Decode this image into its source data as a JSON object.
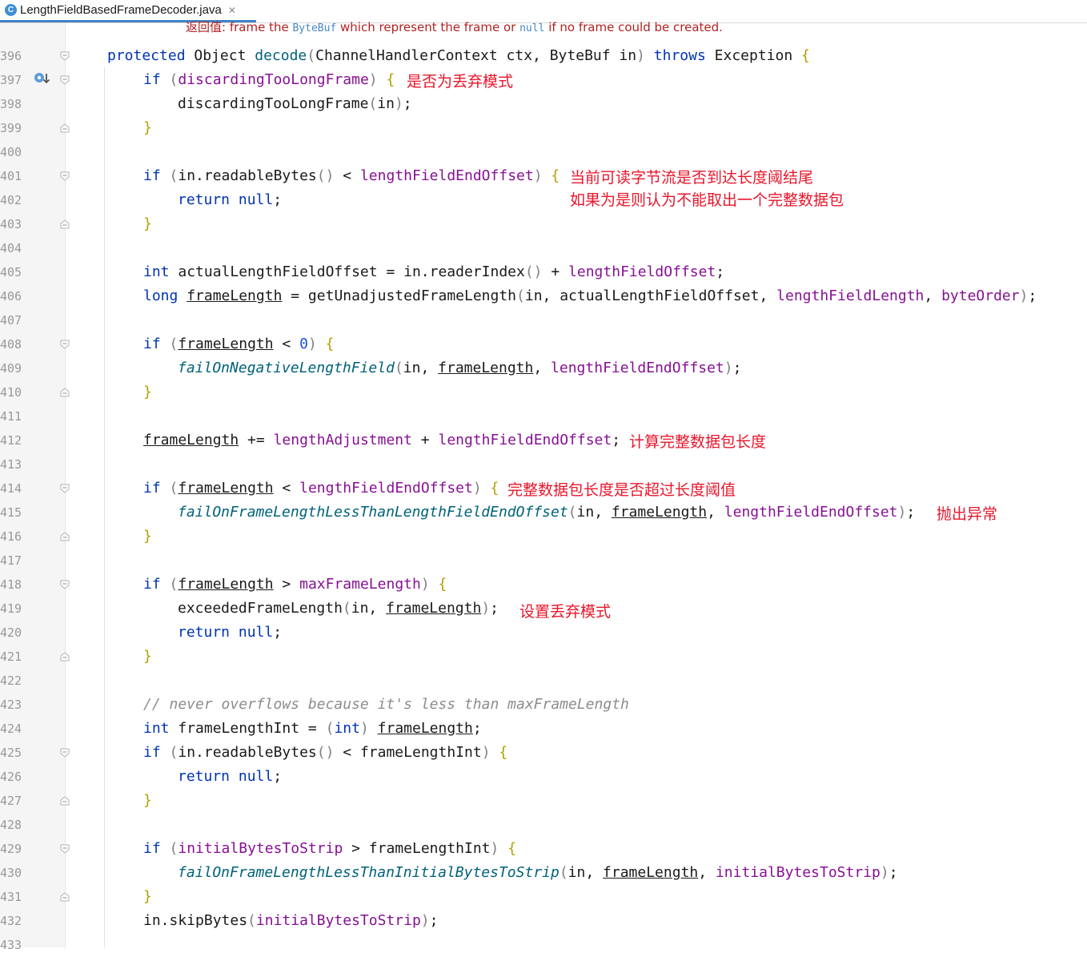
{
  "tab": {
    "icon_letter": "C",
    "title": "LengthFieldBasedFrameDecoder.java",
    "close_glyph": "✕"
  },
  "doc": {
    "label": "返回值:",
    "p1": " frame the ",
    "code1": "ByteBuf",
    "p2": " which represent the frame or ",
    "code2": "null",
    "p3": " if no frame could be created."
  },
  "line_numbers": [
    "396",
    "397",
    "398",
    "399",
    "400",
    "401",
    "402",
    "403",
    "404",
    "405",
    "406",
    "407",
    "408",
    "409",
    "410",
    "411",
    "412",
    "413",
    "414",
    "415",
    "416",
    "417",
    "418",
    "419",
    "420",
    "421",
    "422",
    "423",
    "424",
    "425",
    "426",
    "427",
    "428",
    "429",
    "430",
    "431",
    "432",
    "433"
  ],
  "code": {
    "l396": {
      "kw1": "protected",
      "t1": " Object ",
      "m1": "decode",
      "p1": "(",
      "t2": "ChannelHandlerContext ctx, ByteBuf in",
      "p2": ")",
      "t3": " ",
      "kw2": "throws",
      "t4": " Exception ",
      "b1": "{"
    },
    "l397": {
      "kw1": "if",
      "t1": " ",
      "p1": "(",
      "f1": "discardingTooLongFrame",
      "p2": ")",
      "t2": " ",
      "b1": "{"
    },
    "l398": {
      "t1": "discardingTooLongFrame",
      "p1": "(",
      "t2": "in",
      "p2": ")",
      "t3": ";"
    },
    "l399": {
      "b1": "}"
    },
    "l401": {
      "kw1": "if",
      "t1": " ",
      "p1": "(",
      "t2": "in.readableBytes",
      "p2": "()",
      "t3": " < ",
      "f1": "lengthFieldEndOffset",
      "p3": ")",
      "t4": " ",
      "b1": "{"
    },
    "l402": {
      "kw1": "return",
      "t1": " ",
      "kw2": "null",
      "t2": ";"
    },
    "l403": {
      "b1": "}"
    },
    "l405": {
      "kw1": "int",
      "t1": " actualLengthFieldOffset = in.readerIndex",
      "p1": "()",
      "t2": " + ",
      "f1": "lengthFieldOffset",
      "t3": ";"
    },
    "l406": {
      "kw1": "long",
      "t1": " ",
      "u1": "frameLength",
      "t2": " = getUnadjustedFrameLength",
      "p1": "(",
      "t3": "in, actualLengthFieldOffset, ",
      "f1": "lengthFieldLength",
      "t4": ", ",
      "f2": "byteOrder",
      "p2": ")",
      "t5": ";"
    },
    "l408": {
      "kw1": "if",
      "t1": " ",
      "p1": "(",
      "u1": "frameLength",
      "t2": " < ",
      "n1": "0",
      "p2": ")",
      "t3": " ",
      "b1": "{"
    },
    "l409": {
      "i1": "failOnNegativeLengthField",
      "p1": "(",
      "t1": "in, ",
      "u1": "frameLength",
      "t2": ", ",
      "f1": "lengthFieldEndOffset",
      "p2": ")",
      "t3": ";"
    },
    "l410": {
      "b1": "}"
    },
    "l412": {
      "u1": "frameLength",
      "t1": " += ",
      "f1": "lengthAdjustment",
      "t2": " + ",
      "f2": "lengthFieldEndOffset",
      "t3": ";"
    },
    "l414": {
      "kw1": "if",
      "t1": " ",
      "p1": "(",
      "u1": "frameLength",
      "t2": " < ",
      "f1": "lengthFieldEndOffset",
      "p2": ")",
      "t3": " ",
      "b1": "{"
    },
    "l415": {
      "i1": "failOnFrameLengthLessThanLengthFieldEndOffset",
      "p1": "(",
      "t1": "in, ",
      "u1": "frameLength",
      "t2": ", ",
      "f1": "lengthFieldEndOffset",
      "p2": ")",
      "t3": ";"
    },
    "l416": {
      "b1": "}"
    },
    "l418": {
      "kw1": "if",
      "t1": " ",
      "p1": "(",
      "u1": "frameLength",
      "t2": " > ",
      "f1": "maxFrameLength",
      "p2": ")",
      "t3": " ",
      "b1": "{"
    },
    "l419": {
      "t1": "exceededFrameLength",
      "p1": "(",
      "t2": "in, ",
      "u1": "frameLength",
      "p2": ")",
      "t3": ";"
    },
    "l420": {
      "kw1": "return",
      "t1": " ",
      "kw2": "null",
      "t2": ";"
    },
    "l421": {
      "b1": "}"
    },
    "l423": {
      "c1": "// never overflows because it's less than maxFrameLength"
    },
    "l424": {
      "kw1": "int",
      "t1": " frameLengthInt = ",
      "p1": "(",
      "kw2": "int",
      "p2": ")",
      "t2": " ",
      "u1": "frameLength",
      "t3": ";"
    },
    "l425": {
      "kw1": "if",
      "t1": " ",
      "p1": "(",
      "t2": "in.readableBytes",
      "p2": "()",
      "t3": " < frameLengthInt",
      "p3": ")",
      "t4": " ",
      "b1": "{"
    },
    "l426": {
      "kw1": "return",
      "t1": " ",
      "kw2": "null",
      "t2": ";"
    },
    "l427": {
      "b1": "}"
    },
    "l429": {
      "kw1": "if",
      "t1": " ",
      "p1": "(",
      "f1": "initialBytesToStrip",
      "t2": " > frameLengthInt",
      "p2": ")",
      "t3": " ",
      "b1": "{"
    },
    "l430": {
      "i1": "failOnFrameLengthLessThanInitialBytesToStrip",
      "p1": "(",
      "t1": "in, ",
      "u1": "frameLength",
      "t2": ", ",
      "f1": "initialBytesToStrip",
      "p2": ")",
      "t3": ";"
    },
    "l431": {
      "b1": "}"
    },
    "l432": {
      "t1": "in.skipBytes",
      "p1": "(",
      "f1": "initialBytesToStrip",
      "p2": ")",
      "t2": ";"
    }
  },
  "annotations": {
    "a397": "是否为丢弃模式",
    "a401": "当前可读字节流是否到达长度阈结尾",
    "a402": "如果为是则认为不能取出一个完整数据包",
    "a412": "计算完整数据包长度",
    "a414": "完整数据包长度是否超过长度阈值",
    "a415": "抛出异常",
    "a419": "设置丢弃模式"
  },
  "colors": {
    "keyword": "#0033b3",
    "field": "#871094",
    "annotation_red": "#e8162b",
    "brace": "#b0a000",
    "tab_underline": "#4083c9"
  }
}
